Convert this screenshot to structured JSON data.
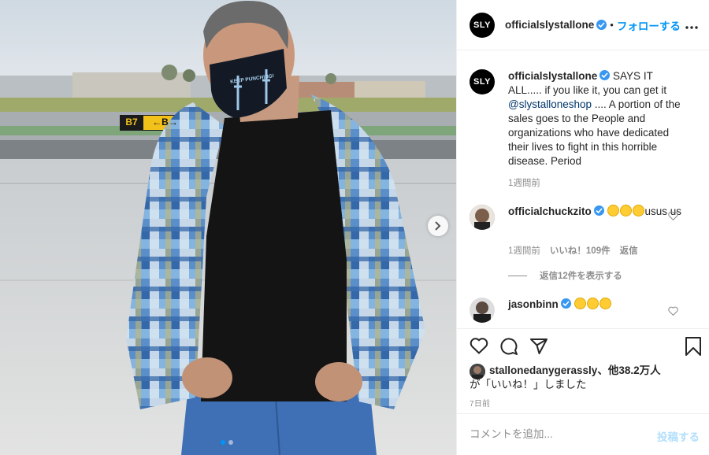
{
  "post": {
    "photo_dots": 2,
    "active_dot": 1
  },
  "header": {
    "avatar_text": "SLY",
    "username": "officialslystallone",
    "separator": "•",
    "follow_label": "フォローする"
  },
  "caption": {
    "avatar_text": "SLY",
    "username": "officialslystallone",
    "text_before": " SAYS IT ALL..... if you like it, you can get it ",
    "mention": "@slystalloneshop",
    "text_after": " .... A portion of the sales goes to the People and organizations who have dedicated their lives to fight in this horrible disease. Period",
    "time": "1週間前"
  },
  "comments": [
    {
      "username": "officialchuckzito",
      "emoji_names": [
        "thumbs-up",
        "folded-hands",
        "hugging-face"
      ],
      "text": "usus us",
      "time": "1週間前",
      "likes": "いいね！109件",
      "reply_label": "返信",
      "view_replies": "返信12件を表示する"
    },
    {
      "username": "jasonbinn",
      "emoji_names": [
        "clapping-hands",
        "clapping-hands",
        "clapping-hands"
      ]
    }
  ],
  "likes": {
    "first_user": "stallonedanygerassly",
    "others": "、他38.2万人",
    "suffix": "が「いいね！」しました"
  },
  "timestamp": "7日前",
  "add_comment": {
    "placeholder": "コメントを追加...",
    "post_label": "投稿する"
  },
  "mask_text": "KEEP PUNCHING!",
  "taxiway_sign": {
    "location": "B7",
    "direction": "←B→"
  },
  "colors": {
    "accent_blue": "#0095f6",
    "verified_blue": "#3897f0",
    "mention": "#00376b",
    "muted": "#8e8e8e",
    "text": "#262626"
  }
}
